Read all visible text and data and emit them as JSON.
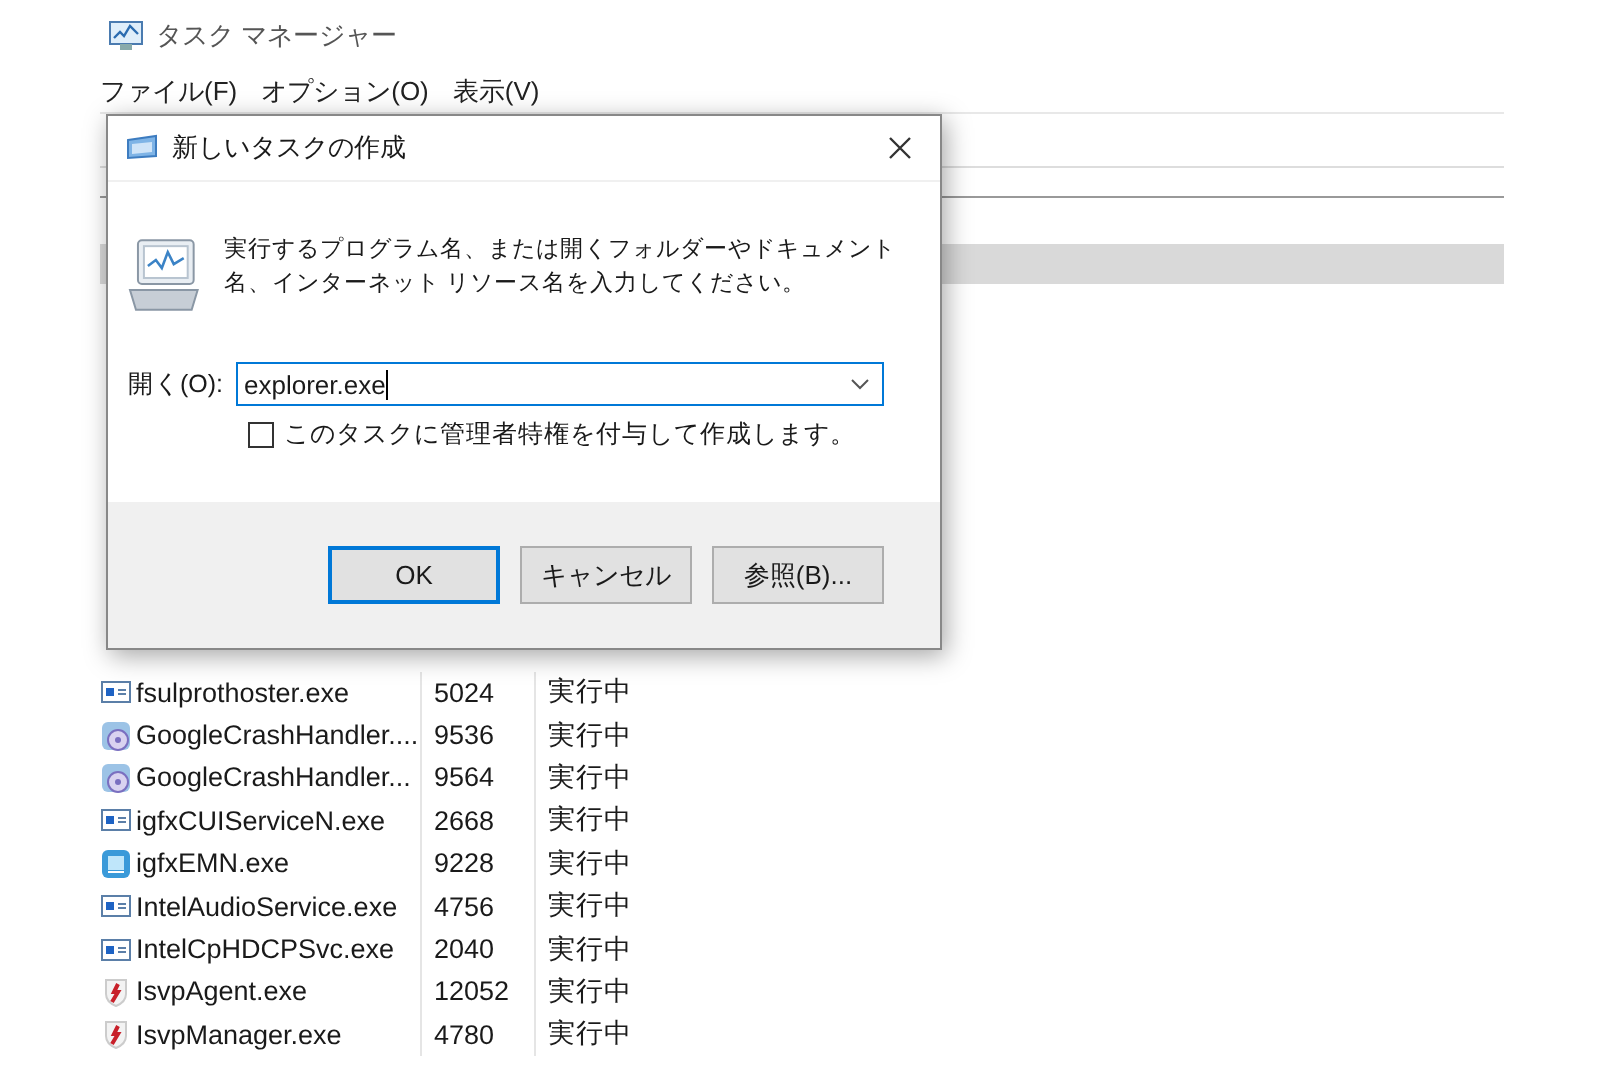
{
  "window": {
    "title": "タスク マネージャー"
  },
  "menu": [
    {
      "label": "ファイル(F)"
    },
    {
      "label": "オプション(O)"
    },
    {
      "label": "表示(V)"
    }
  ],
  "process_table": {
    "rows": [
      {
        "name": "fsulprothoster.exe",
        "pid": "5024",
        "status": "実行中",
        "kind": "app"
      },
      {
        "name": "GoogleCrashHandler....",
        "pid": "9536",
        "status": "実行中",
        "kind": "google"
      },
      {
        "name": "GoogleCrashHandler...",
        "pid": "9564",
        "status": "実行中",
        "kind": "google"
      },
      {
        "name": "igfxCUIServiceN.exe",
        "pid": "2668",
        "status": "実行中",
        "kind": "app"
      },
      {
        "name": "igfxEMN.exe",
        "pid": "9228",
        "status": "実行中",
        "kind": "igfx"
      },
      {
        "name": "IntelAudioService.exe",
        "pid": "4756",
        "status": "実行中",
        "kind": "app"
      },
      {
        "name": "IntelCpHDCPSvc.exe",
        "pid": "2040",
        "status": "実行中",
        "kind": "app"
      },
      {
        "name": "IsvpAgent.exe",
        "pid": "12052",
        "status": "実行中",
        "kind": "shield"
      },
      {
        "name": "IsvpManager.exe",
        "pid": "4780",
        "status": "実行中",
        "kind": "shield"
      }
    ]
  },
  "dialog": {
    "title": "新しいタスクの作成",
    "message": "実行するプログラム名、または開くフォルダーやドキュメント名、インターネット リソース名を入力してください。",
    "open_label": "開く(O):",
    "open_value": "explorer.exe",
    "admin_checkbox": {
      "label": "このタスクに管理者特権を付与して作成します。",
      "checked": false
    },
    "buttons": [
      {
        "label": "OK",
        "default": true
      },
      {
        "label": "キャンセル",
        "default": false
      },
      {
        "label": "参照(B)...",
        "default": false
      }
    ]
  }
}
